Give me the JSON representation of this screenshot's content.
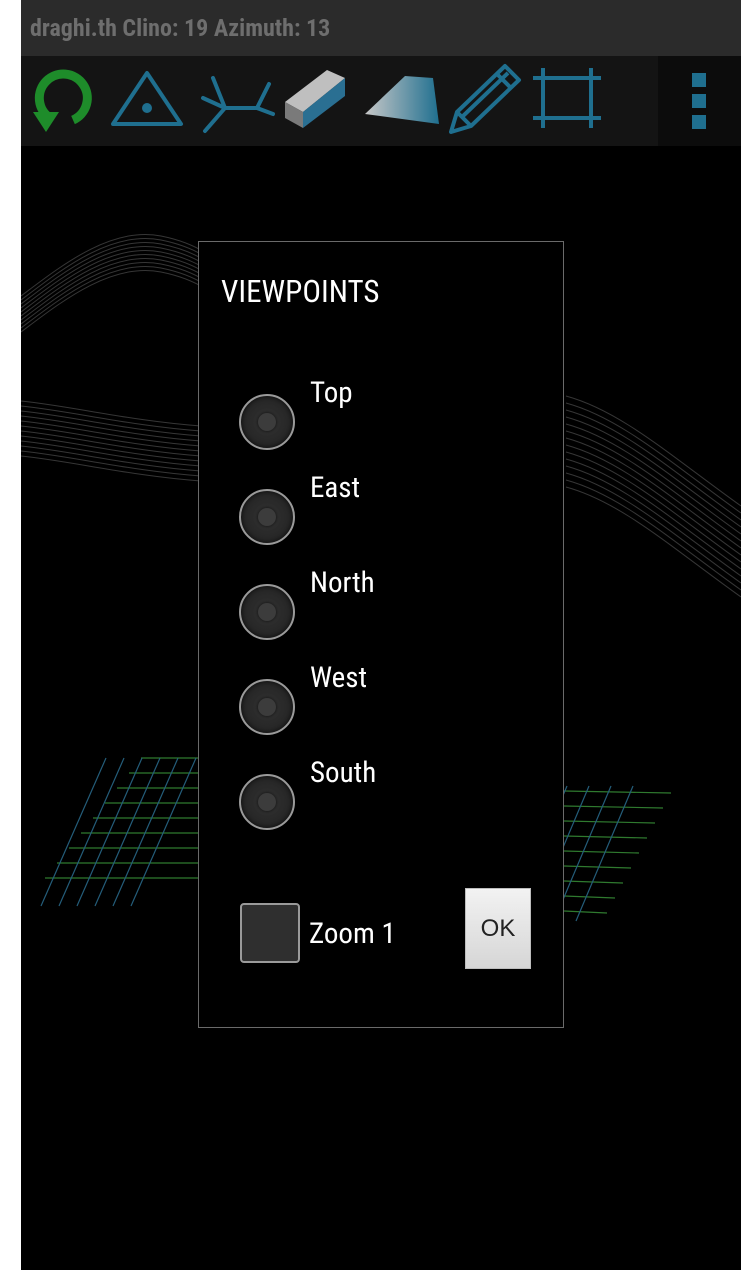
{
  "title_bar": {
    "text": "draghi.th Clino: 19 Azimuth: 13"
  },
  "toolbar": {
    "tools": [
      {
        "icon": "refresh-icon",
        "color": "#1e8c2a"
      },
      {
        "icon": "station-triangle-icon",
        "color": "#1f6f8f"
      },
      {
        "icon": "splay-legs-icon",
        "color": "#1f6f8f"
      },
      {
        "icon": "wall-block-icon",
        "color": "#1f6f8f"
      },
      {
        "icon": "surface-plane-icon",
        "color": "#1f6f8f"
      },
      {
        "icon": "pencil-icon",
        "color": "#1f6f8f"
      },
      {
        "icon": "frame-icon",
        "color": "#1f6f8f"
      }
    ],
    "menu_icon": "overflow-menu-icon"
  },
  "dialog": {
    "title": "VIEWPOINTS",
    "options": [
      {
        "label": "Top",
        "selected": false
      },
      {
        "label": "East",
        "selected": false
      },
      {
        "label": "North",
        "selected": false
      },
      {
        "label": "West",
        "selected": false
      },
      {
        "label": "South",
        "selected": false
      }
    ],
    "zoom_checkbox": {
      "label": "Zoom 1",
      "checked": false
    },
    "ok_label": "OK"
  },
  "colors": {
    "background": "#000000",
    "title_bar": "#2b2b2b",
    "toolbar": "#141414",
    "accent_blue": "#1f6f8f",
    "accent_green": "#1e8c2a",
    "dialog_border": "#6a6a6a",
    "grid_green": "#2f7a2f",
    "grid_blue": "#245d7a"
  }
}
